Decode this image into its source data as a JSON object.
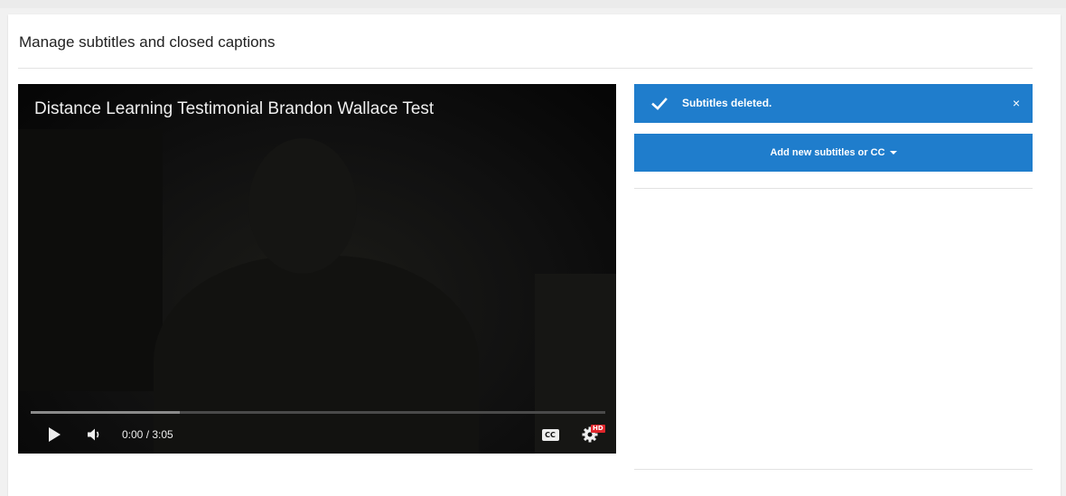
{
  "page": {
    "title": "Manage subtitles and closed captions"
  },
  "player": {
    "video_title": "Distance Learning Testimonial Brandon Wallace Test",
    "time_display": "0:00 / 3:05",
    "buffered_fraction": 0.26,
    "play_icon": "play-icon",
    "volume_icon": "volume-icon",
    "cc_label": "CC",
    "settings_icon": "gear-icon",
    "hd_badge": "HD"
  },
  "alert": {
    "message": "Subtitles deleted.",
    "close_symbol": "×",
    "icon": "check-icon"
  },
  "add_button": {
    "label": "Add new subtitles or CC",
    "icon": "caret-down-icon"
  },
  "colors": {
    "accent": "#1f7dcc",
    "hd_badge": "#e0252b"
  }
}
